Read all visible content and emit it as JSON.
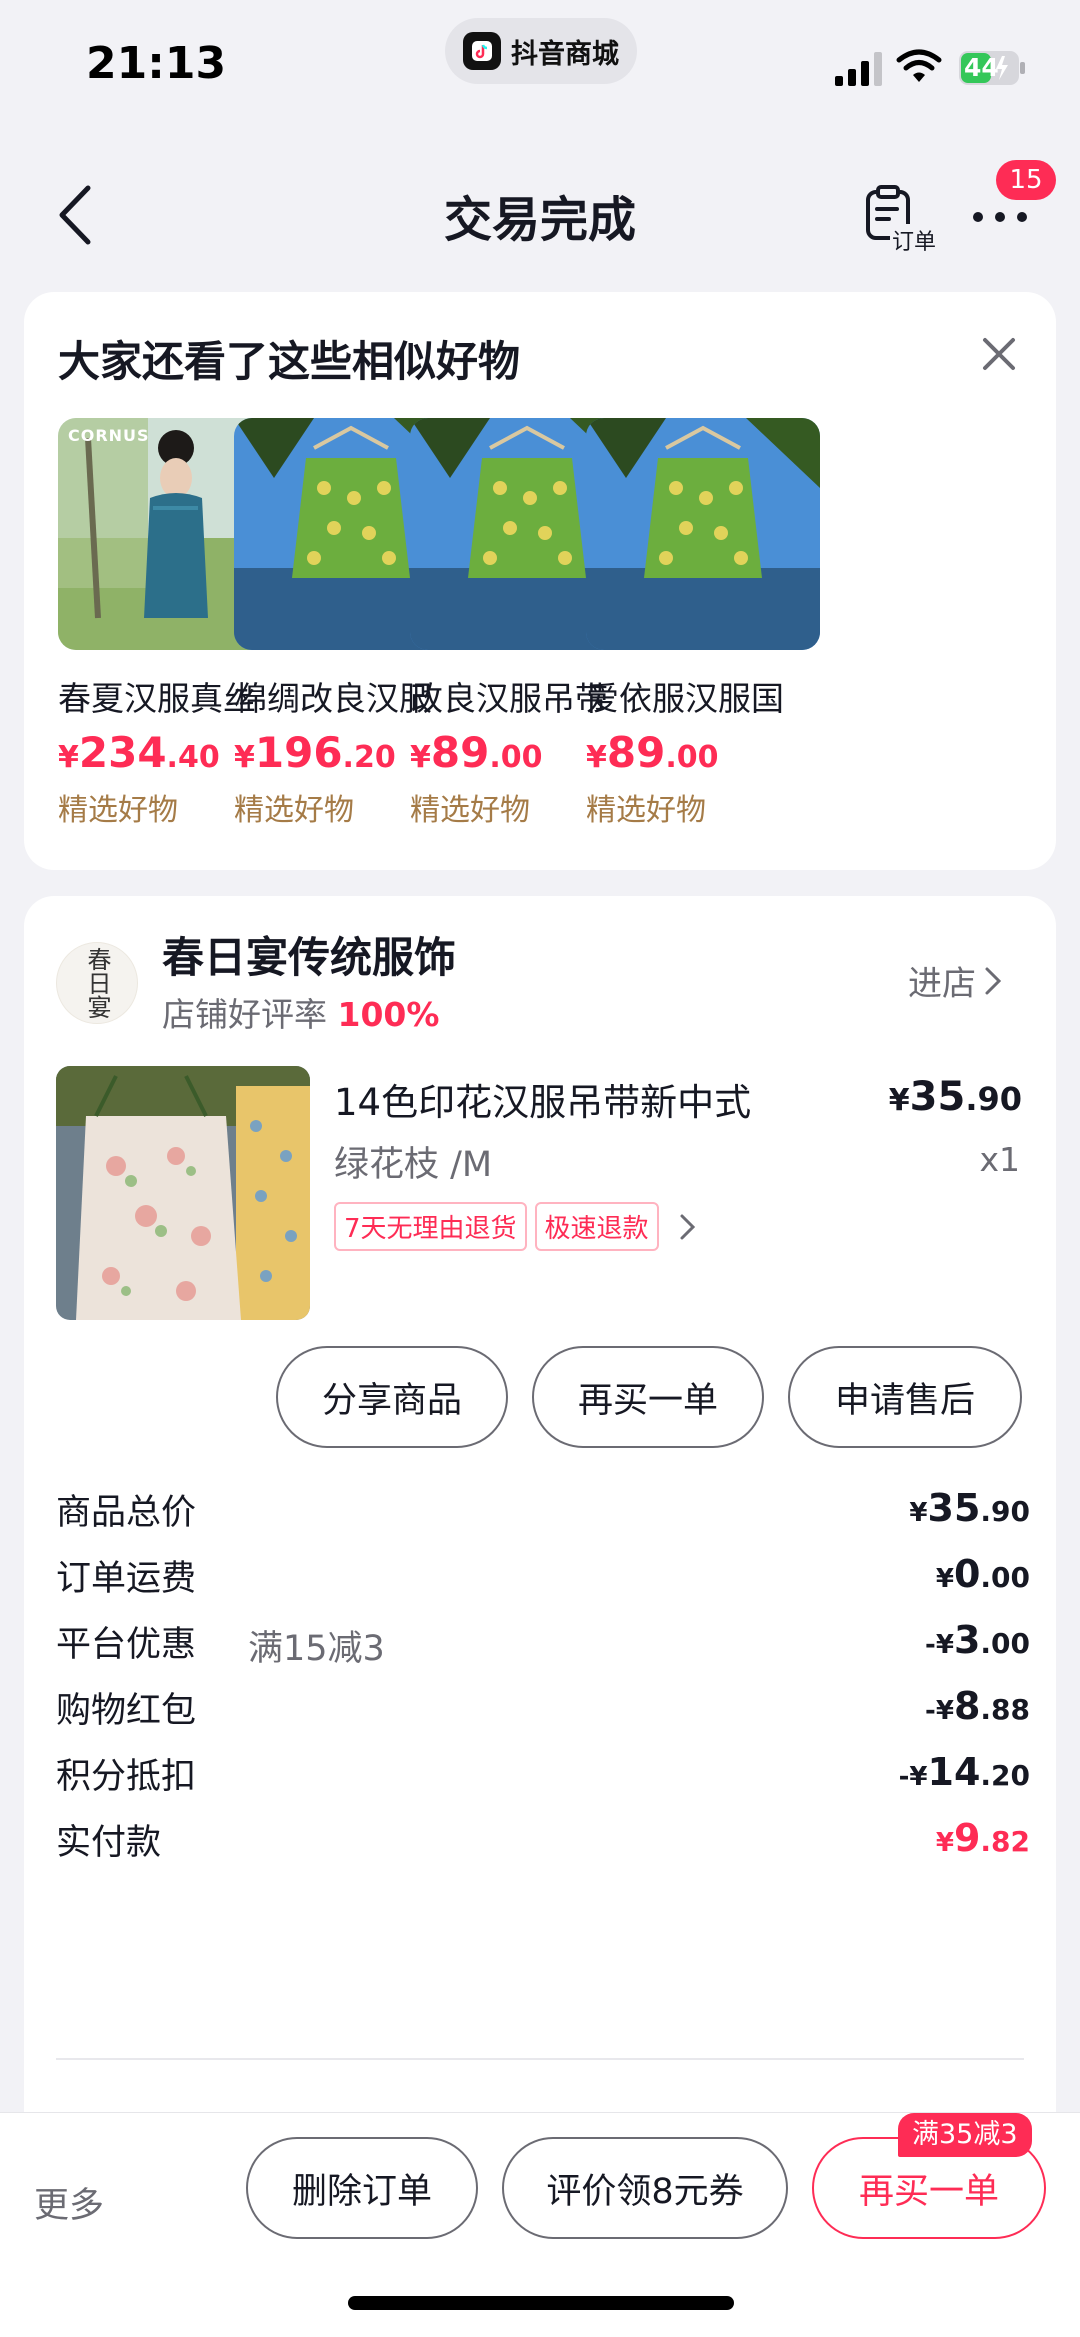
{
  "status_bar": {
    "time": "21:13",
    "app_pill": "抖音商城",
    "battery": "44"
  },
  "nav": {
    "title": "交易完成",
    "order_label": "订单",
    "badge": "15"
  },
  "recommend": {
    "title": "大家还看了这些相似好物",
    "items": [
      {
        "name": "春夏汉服真丝",
        "price_int": "234",
        "price_dec": ".40",
        "tag": "精选好物",
        "watermark": "CORNUS"
      },
      {
        "name": "棉绸改良汉服",
        "price_int": "196",
        "price_dec": ".20",
        "tag": "精选好物"
      },
      {
        "name": "改良汉服吊带",
        "price_int": "89",
        "price_dec": ".00",
        "tag": "精选好物"
      },
      {
        "name": "爱依服汉服国",
        "price_int": "89",
        "price_dec": ".00",
        "tag": "精选好物"
      }
    ],
    "currency": "¥"
  },
  "shop": {
    "avatar_text": "春日宴",
    "name": "春日宴传统服饰",
    "rating_label": "店铺好评率",
    "rating_value": "100%",
    "enter_label": "进店"
  },
  "product": {
    "title": "14色印花汉服吊带新中式",
    "price_int": "35",
    "price_dec": ".90",
    "spec": "绿花枝 /M",
    "qty": "x1",
    "tags": [
      "7天无理由退货",
      "极速退款"
    ]
  },
  "actions": {
    "share": "分享商品",
    "rebuy": "再买一单",
    "after_sale": "申请售后"
  },
  "fees": [
    {
      "label": "商品总价",
      "sub": "",
      "prefix": "",
      "int": "35",
      "dec": ".90",
      "red": false
    },
    {
      "label": "订单运费",
      "sub": "",
      "prefix": "",
      "int": "0",
      "dec": ".00",
      "red": false
    },
    {
      "label": "平台优惠",
      "sub": "满15减3",
      "prefix": "-",
      "int": "3",
      "dec": ".00",
      "red": false
    },
    {
      "label": "购物红包",
      "sub": "",
      "prefix": "-",
      "int": "8",
      "dec": ".88",
      "red": false
    },
    {
      "label": "积分抵扣",
      "sub": "",
      "prefix": "-",
      "int": "14",
      "dec": ".20",
      "red": false
    },
    {
      "label": "实付款",
      "sub": "",
      "prefix": "",
      "int": "9",
      "dec": ".82",
      "red": true
    }
  ],
  "bottom": {
    "more": "更多",
    "delete": "删除订单",
    "review": "评价领8元券",
    "rebuy": "再买一单",
    "promo": "满35减3"
  },
  "colors": {
    "accent": "#fe2c55",
    "tag_gold": "#a57b47",
    "bg": "#f2f2f6"
  }
}
